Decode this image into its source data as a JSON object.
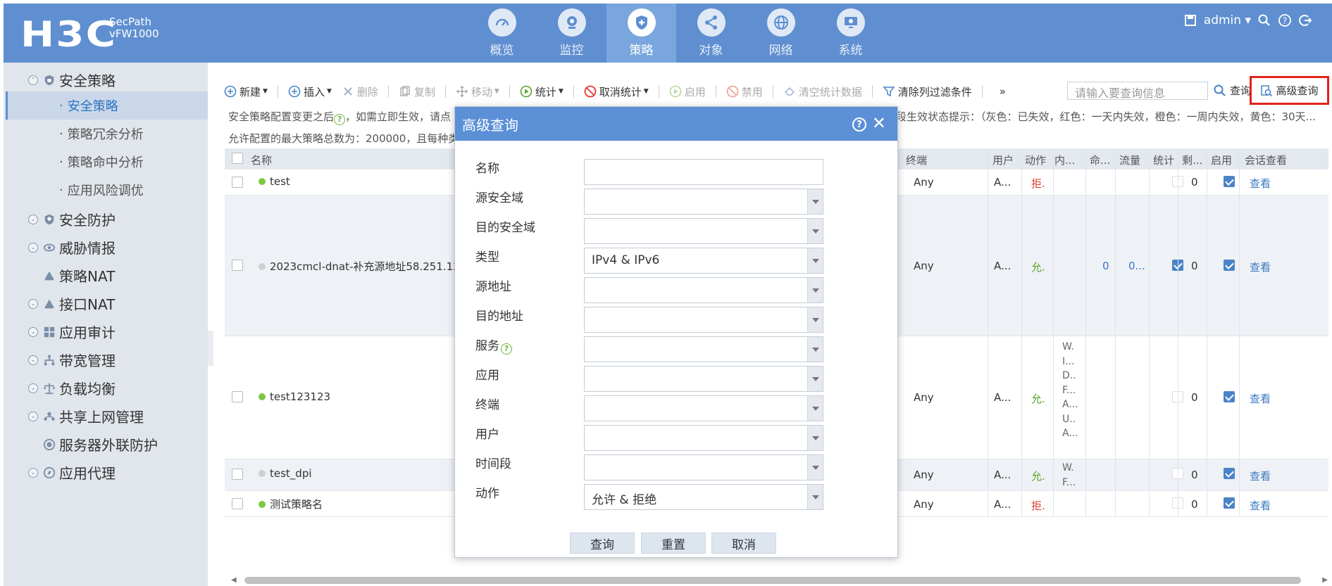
{
  "header": {
    "logo": "H3C",
    "product_line1": "SecPath",
    "product_line2": "vFW1000",
    "nav": [
      {
        "label": "概览",
        "icon": "gauge-icon"
      },
      {
        "label": "监控",
        "icon": "camera-icon"
      },
      {
        "label": "策略",
        "icon": "shield-icon",
        "active": true
      },
      {
        "label": "对象",
        "icon": "share-nodes-icon"
      },
      {
        "label": "网络",
        "icon": "globe-icon"
      },
      {
        "label": "系统",
        "icon": "monitor-icon"
      }
    ],
    "user": "admin"
  },
  "sidebar": {
    "groups": [
      {
        "label": "安全策略",
        "expanded": true
      },
      {
        "label": "安全防护"
      },
      {
        "label": "威胁情报"
      },
      {
        "label": "策略NAT"
      },
      {
        "label": "接口NAT"
      },
      {
        "label": "应用审计"
      },
      {
        "label": "带宽管理"
      },
      {
        "label": "负载均衡"
      },
      {
        "label": "共享上网管理"
      },
      {
        "label": "服务器外联防护"
      },
      {
        "label": "应用代理"
      }
    ],
    "subitems": [
      "安全策略",
      "策略冗余分析",
      "策略命中分析",
      "应用风险调优"
    ]
  },
  "toolbar": {
    "new": "新建",
    "insert": "插入",
    "delete": "删除",
    "copy": "复制",
    "move": "移动",
    "stats": "统计",
    "cancel_stats": "取消统计",
    "enable": "启用",
    "disable": "禁用",
    "clear_stats": "清空统计数据",
    "clear_filter": "清除列过滤条件",
    "more": "»",
    "search_placeholder": "请输入要查询信息",
    "search": "查询",
    "advanced": "高级查询"
  },
  "info": {
    "line1_left": "安全策略配置变更之后",
    "line1_mid": "，如需立即生效，请点",
    "line1_right": "间段生效状态提示：（灰色：已失效，红色：一天内失效，橙色：一周内失效，黄色：30天...",
    "line2": "允许配置的最大策略总数为：200000，且每种类"
  },
  "table": {
    "columns": [
      "名称",
      "终端",
      "用户",
      "动作",
      "内...",
      "命...",
      "流量",
      "统计",
      "剩...",
      "启用",
      "会话查看"
    ],
    "rows": [
      {
        "name": "test",
        "status_color": "#7ac943",
        "terminal": "Any",
        "user": "A...",
        "action": "拒.",
        "action_type": "deny",
        "content": "",
        "hits": "",
        "traffic": "",
        "stats": false,
        "remain": "0",
        "enabled": true,
        "view": "查看"
      },
      {
        "name": "2023cmcl-dnat-补充源地址58.251.128",
        "status_color": "#cfcfcf",
        "terminal": "Any",
        "user": "A...",
        "action": "允.",
        "action_type": "allow",
        "content": "",
        "hits": "0",
        "traffic": "0...",
        "stats": true,
        "remain": "0",
        "enabled": true,
        "view": "查看"
      },
      {
        "name": "test123123",
        "status_color": "#7ac943",
        "terminal": "Any",
        "user": "A...",
        "action": "允.",
        "action_type": "allow",
        "content_lines": [
          "W.",
          "I...",
          "D..",
          "F...",
          "A...",
          "U..",
          "A..."
        ],
        "hits": "",
        "traffic": "",
        "stats": false,
        "remain": "0",
        "enabled": true,
        "view": "查看"
      },
      {
        "name": "test_dpi",
        "status_color": "#cfcfcf",
        "terminal": "Any",
        "user": "A...",
        "action": "允.",
        "action_type": "allow",
        "content_lines": [
          "W.",
          "F..."
        ],
        "hits": "",
        "traffic": "",
        "stats": false,
        "remain": "0",
        "enabled": true,
        "view": "查看"
      },
      {
        "name": "测试策略名",
        "status_color": "#7ac943",
        "terminal": "Any",
        "user": "A...",
        "action": "拒.",
        "action_type": "deny",
        "content": "",
        "hits": "",
        "traffic": "",
        "stats": false,
        "remain": "0",
        "enabled": true,
        "view": "查看"
      }
    ]
  },
  "dialog": {
    "title": "高级查询",
    "help": "?",
    "close": "✕",
    "fields": {
      "name": {
        "label": "名称",
        "value": ""
      },
      "src_zone": {
        "label": "源安全域",
        "value": ""
      },
      "dst_zone": {
        "label": "目的安全域",
        "value": ""
      },
      "type": {
        "label": "类型",
        "value": "IPv4 & IPv6"
      },
      "src_addr": {
        "label": "源地址",
        "value": ""
      },
      "dst_addr": {
        "label": "目的地址",
        "value": ""
      },
      "service": {
        "label": "服务",
        "value": ""
      },
      "app": {
        "label": "应用",
        "value": ""
      },
      "terminal": {
        "label": "终端",
        "value": ""
      },
      "user": {
        "label": "用户",
        "value": ""
      },
      "time": {
        "label": "时间段",
        "value": ""
      },
      "action": {
        "label": "动作",
        "value": "允许 & 拒绝"
      }
    },
    "buttons": {
      "query": "查询",
      "reset": "重置",
      "cancel": "取消"
    }
  },
  "colors": {
    "header": "#5f8fd0",
    "header_active": "#78a6dd",
    "sidebar": "#e1e6ec",
    "accent": "#3a78c4",
    "dialog_title": "#5b8fd6",
    "highlight_box": "#e2231a"
  }
}
